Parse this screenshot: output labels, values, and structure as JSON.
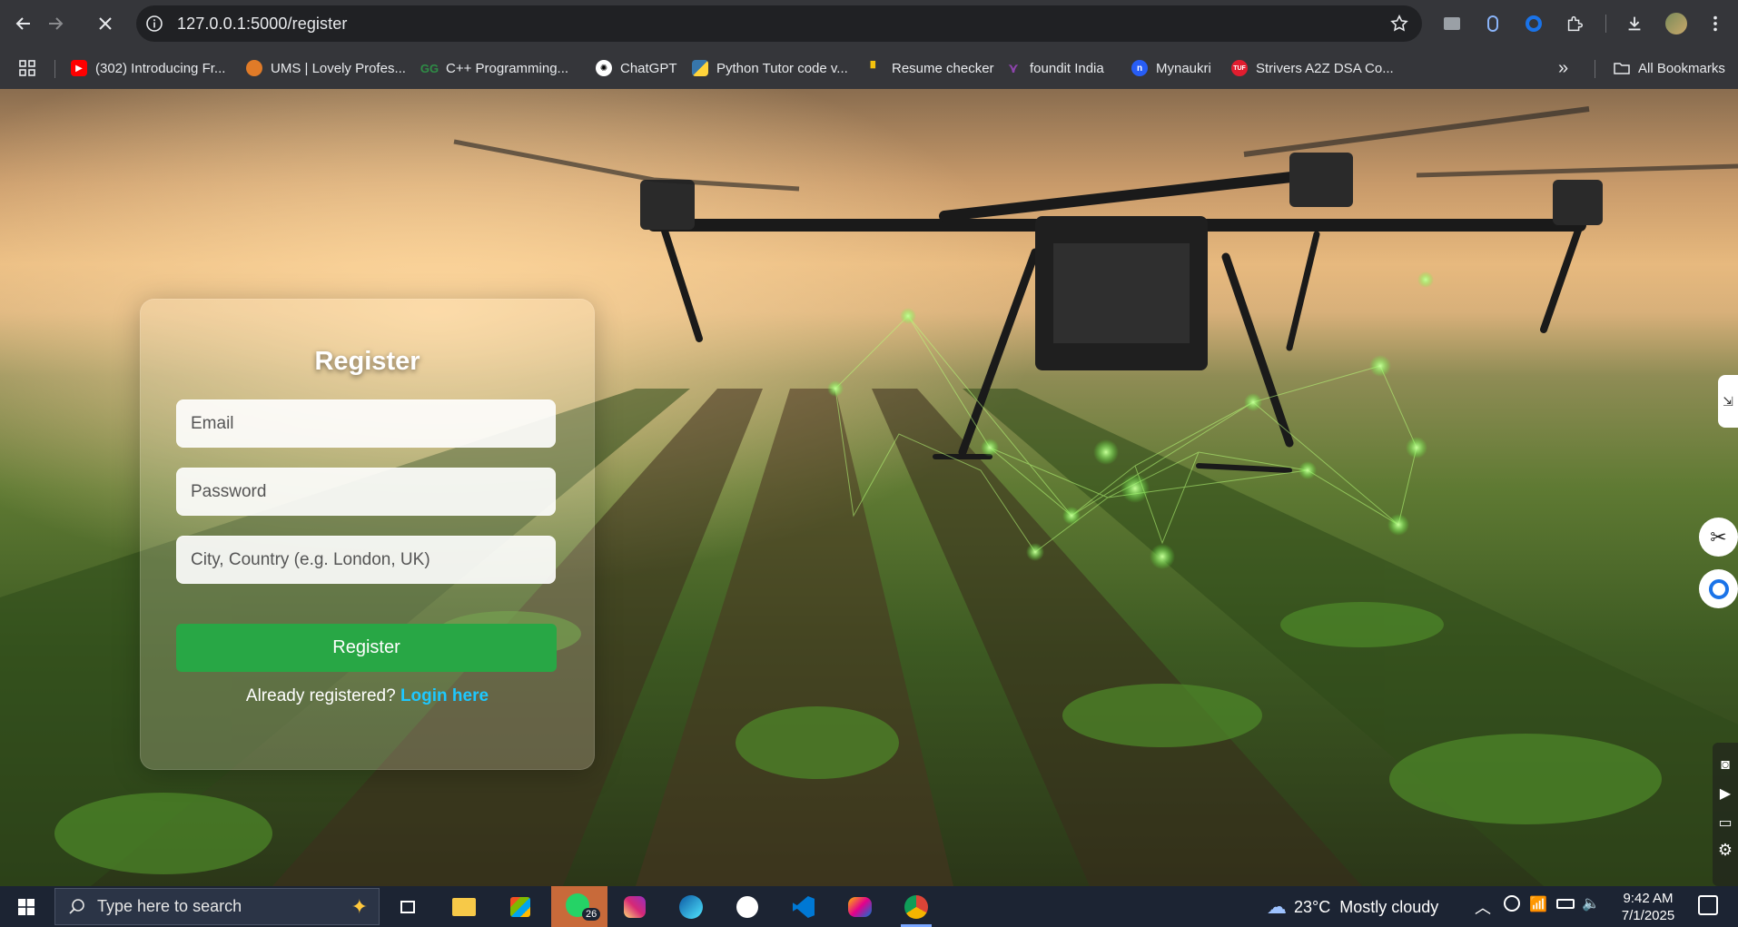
{
  "browser": {
    "url": "127.0.0.1:5000/register",
    "bookmarks": [
      {
        "label": "(302) Introducing Fr...",
        "icon": "youtube-icon"
      },
      {
        "label": "UMS | Lovely Profes...",
        "icon": "ums-icon"
      },
      {
        "label": "C++ Programming...",
        "icon": "geeksforgeeks-icon"
      },
      {
        "label": "ChatGPT",
        "icon": "chatgpt-icon"
      },
      {
        "label": "Python Tutor code v...",
        "icon": "python-icon"
      },
      {
        "label": "Resume checker",
        "icon": "resume-icon"
      },
      {
        "label": "foundit India",
        "icon": "foundit-icon"
      },
      {
        "label": "Mynaukri",
        "icon": "naukri-icon"
      },
      {
        "label": "Strivers A2Z DSA Co...",
        "icon": "tuf-icon"
      }
    ],
    "all_bookmarks_label": "All Bookmarks"
  },
  "form": {
    "title": "Register",
    "email_placeholder": "Email",
    "password_placeholder": "Password",
    "city_placeholder": "City, Country (e.g. London, UK)",
    "submit_label": "Register",
    "login_prompt": "Already registered?",
    "login_link": "Login here"
  },
  "taskbar": {
    "search_placeholder": "Type here to search",
    "whatsapp_badge": "26",
    "weather": "23°C  Mostly cloudy",
    "time": "9:42 AM",
    "date": "7/1/2025"
  }
}
